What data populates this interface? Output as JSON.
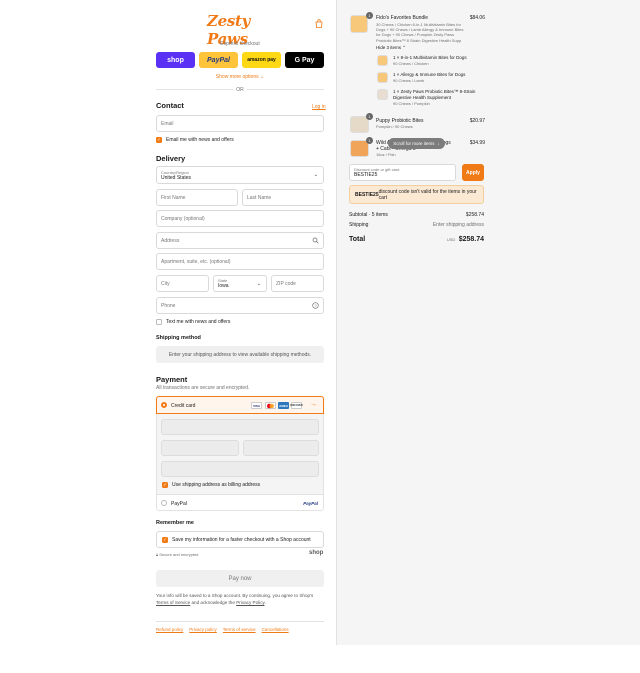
{
  "brand": {
    "logo_text": "Zesty Paws",
    "accent": "#f07a16"
  },
  "express": {
    "label": "Express checkout",
    "buttons": [
      "shop",
      "PayPal",
      "amazon pay",
      "G Pay"
    ],
    "show_more": "Show more options",
    "or": "OR"
  },
  "contact": {
    "heading": "Contact",
    "login": "Log in",
    "email_placeholder": "Email",
    "news_label": "Email me with news and offers"
  },
  "delivery": {
    "heading": "Delivery",
    "country_label": "Country/Region",
    "country_value": "United States",
    "first_name": "First Name",
    "last_name": "Last Name",
    "company": "Company (optional)",
    "address": "Address",
    "apartment": "Apartment, suite, etc. (optional)",
    "city": "City",
    "state_label": "State",
    "state_value": "Iowa",
    "zip": "ZIP code",
    "phone": "Phone",
    "text_label": "Text me with news and offers"
  },
  "shipping_method": {
    "heading": "Shipping method",
    "message": "Enter your shipping address to view available shipping methods."
  },
  "payment": {
    "heading": "Payment",
    "subtitle": "All transactions are secure and encrypted.",
    "credit_card": "Credit card",
    "card_brands": [
      "VISA",
      "MC",
      "AMEX",
      "DISCOVER"
    ],
    "billing_label": "Use shipping address as billing address",
    "paypal": "PayPal",
    "paypal_logo": "PayPal"
  },
  "remember": {
    "heading": "Remember me",
    "label": "Save my information for a faster checkout with a Shop account",
    "secure": "Secure and encrypted",
    "shop": "shop"
  },
  "paynow": "Pay now",
  "legal": {
    "line1": "Your info will be saved to a Shop account. By continuing, you agree to Shop's",
    "terms": "Terms of Service",
    "and": " and acknowledge the ",
    "privacy": "Privacy Policy",
    "dot": "."
  },
  "footer": [
    "Refund policy",
    "Privacy policy",
    "Terms of service",
    "Cancellations"
  ],
  "cart": {
    "items": [
      {
        "qty": "1",
        "title": "Fido's Favorites Bundle",
        "sub": [
          "30 Chews / Chicken 6-in-1 Multivitamin Bites for",
          "Dogs + 90 Chews / Lamb Allergy & Immune Bites",
          "for Dogs + 90 Chews / Pumpkin Zesty Paws",
          "Probiotic Bites™ 8 Strain Digestive Health Supp"
        ],
        "price": "$84.06",
        "toggle": "Hide 3 items",
        "sub_items": [
          {
            "title": "1 × 8-in-1 Multivitamin Bites for Dogs",
            "sub": "90 Chews / Chicken"
          },
          {
            "title": "1 × Allergy & Immune Bites for Dogs",
            "sub": "90 Chews / Lamb"
          },
          {
            "title": "1 × Zesty Paws Probiotic Bites™ 8-Strain",
            "title2": "Digestive Health Supplement",
            "sub": "90 Chews / Pumpkin"
          }
        ]
      },
      {
        "qty": "1",
        "title": "Puppy Probiotic Bites",
        "sub": "Pumpkin / 90 Chews",
        "price": "$20.97"
      },
      {
        "qty": "1",
        "title": "Wild Alaskan Salmon Oil for Dogs + Cats - Omega 3",
        "sub": "16oz / Fish",
        "price": "$34.99"
      }
    ],
    "scroll_tip": "Scroll for more items",
    "discount_label": "Discount code or gift card",
    "discount_value": "BESTIE25",
    "apply": "Apply",
    "warning_code": "BESTIE25",
    "warning_text": " discount code isn't valid for the items in your cart",
    "subtotal_label": "Subtotal · 5 items",
    "subtotal_value": "$258.74",
    "shipping_label": "Shipping",
    "shipping_value": "Enter shipping address",
    "total_label": "Total",
    "currency": "USD",
    "total_value": "$258.74"
  }
}
